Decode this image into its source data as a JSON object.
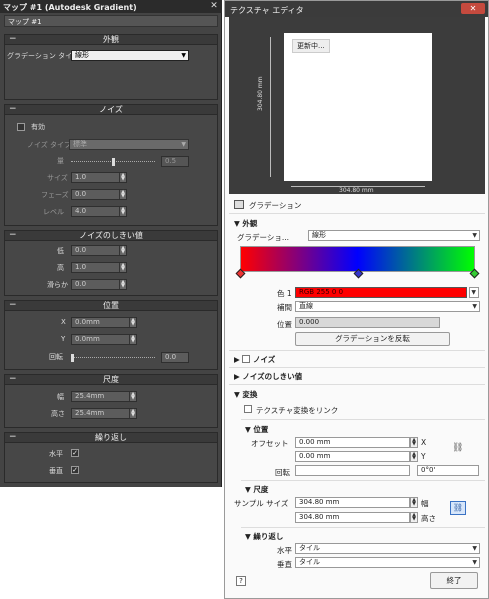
{
  "left": {
    "title": "マップ #1 (Autodesk Gradient)",
    "close": "✕",
    "map_name": "マップ #1",
    "appearance": {
      "header": "外観",
      "type_label": "グラデーション タイプ",
      "type_value": "線形"
    },
    "noise": {
      "header": "ノイズ",
      "enabled_label": "有効",
      "type_label": "ノイズ タイプ",
      "type_value": "標準",
      "amount_label": "量",
      "amount_value": "0.5",
      "amount_level": 0.5,
      "size_label": "サイズ",
      "size_value": "1.0",
      "phase_label": "フェーズ",
      "phase_value": "0.0",
      "level_label": "レベル",
      "level_value": "4.0"
    },
    "threshold": {
      "header": "ノイズのしきい値",
      "low_label": "低",
      "low_value": "0.0",
      "high_label": "高",
      "high_value": "1.0",
      "smooth_label": "滑らか",
      "smooth_value": "0.0"
    },
    "position": {
      "header": "位置",
      "x_label": "X",
      "x_value": "0.0mm",
      "y_label": "Y",
      "y_value": "0.0mm",
      "rot_label": "回転",
      "rot_value": "0.0",
      "rot_level": 0.0
    },
    "scale": {
      "header": "尺度",
      "w_label": "幅",
      "w_value": "25.4mm",
      "h_label": "高さ",
      "h_value": "25.4mm"
    },
    "repeat": {
      "header": "繰り返し",
      "h_label": "水平",
      "v_label": "垂直"
    }
  },
  "right": {
    "title": "テクスチャ エディタ",
    "close": "✕",
    "updating": "更新中...",
    "dim_v": "304.80 mm",
    "dim_h": "304.80 mm",
    "gradient_label": "グラデーション",
    "appearance": "外観",
    "grad_type_label": "グラデーショ...",
    "grad_type_value": "線形",
    "color_label": "色 1",
    "color_value": "RGB 255 0 0",
    "interp_label": "補間",
    "interp_value": "直線",
    "pos_label": "位置",
    "pos_value": "0.000",
    "reverse_btn": "グラデーションを反転",
    "noise_label": "ノイズ",
    "threshold_label": "ノイズのしきい値",
    "transform_label": "変換",
    "link_label": "テクスチャ変換をリンク",
    "position_label": "位置",
    "offset_label": "オフセット",
    "offset_x": "0.00 mm",
    "offset_y": "0.00 mm",
    "x": "X",
    "y": "Y",
    "rot_label": "回転",
    "rot_value": "0°0'",
    "scale_label": "尺度",
    "sample_label": "サンプル サイズ",
    "sample_w": "304.80 mm",
    "sample_h": "304.80 mm",
    "w": "幅",
    "h": "高さ",
    "repeat_label": "繰り返し",
    "h_label": "水平",
    "h_value": "タイル",
    "v_label": "垂直",
    "v_value": "タイル",
    "help": "?",
    "done_btn": "終了"
  },
  "colors": {
    "stop_left": "#ff0000",
    "stop_mid": "#0000ff",
    "stop_right": "#00ff00"
  }
}
